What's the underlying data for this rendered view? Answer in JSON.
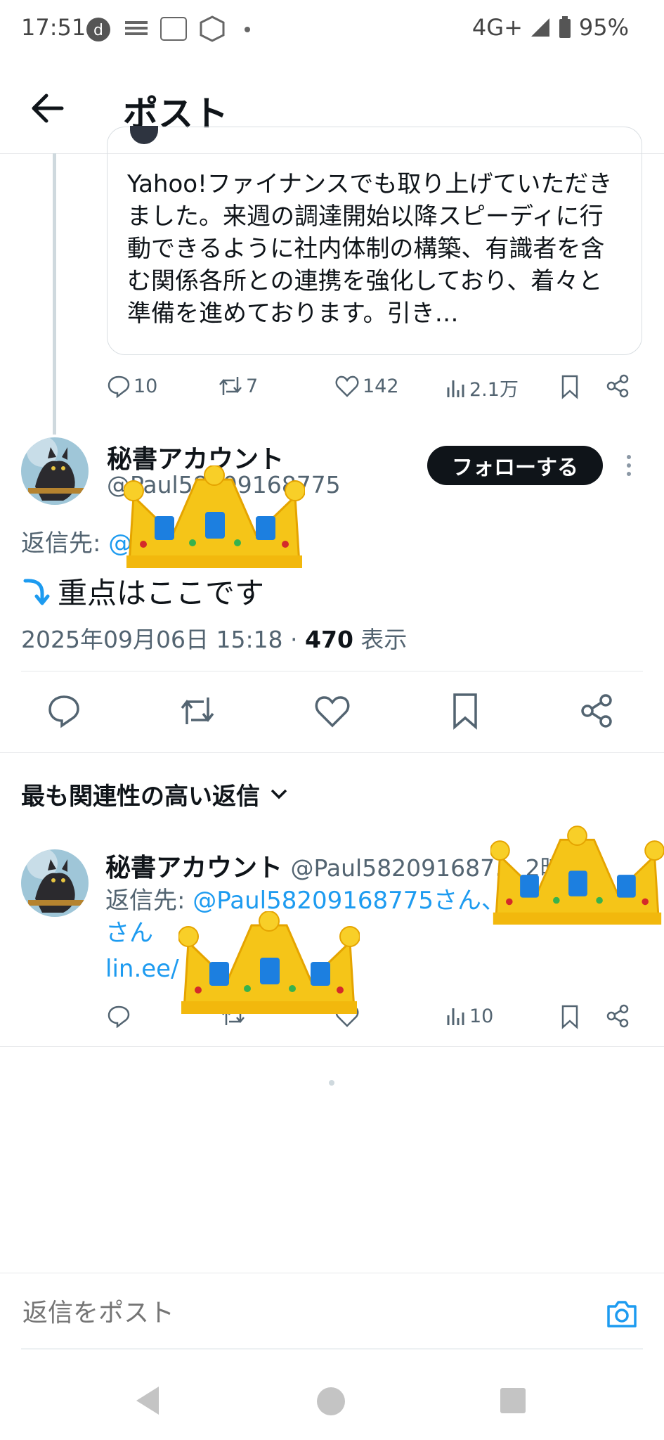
{
  "status_bar": {
    "time": "17:51",
    "network": "4G+",
    "battery": "95%"
  },
  "header": {
    "title": "ポスト"
  },
  "quoted_post": {
    "text": "Yahoo!ファイナンスでも取り上げていただきました。来週の調達開始以降スピーディに行動できるように社内体制の構築、有識者を含む関係各所との連携を強化しており、着々と準備を進めております。引き…",
    "replies": "10",
    "reposts": "7",
    "likes": "142",
    "views": "2.1万"
  },
  "main_post": {
    "name": "秘書アカウント",
    "handle": "@Paul58209168775",
    "follow_label": "フォローする",
    "reply_to_label": "返信先:",
    "reply_to_handle": "@",
    "text": "重点はここです",
    "timestamp": "2025年09月06日 15:18 · ",
    "views": "470",
    "views_label": " 表示"
  },
  "replies_section": {
    "title": "最も関連性の高い返信"
  },
  "reply_post": {
    "name": "秘書アカウント",
    "handle_time": "@Paul582091687… 2時間",
    "reply_to_label": "返信先: ",
    "reply_to_handles": "@Paul58209168775さん、",
    "reply_to_suffix": "さん",
    "link": "lin.ee/",
    "views": "10"
  },
  "compose": {
    "placeholder": "返信をポスト"
  },
  "colors": {
    "accent": "#1d9bf0",
    "text": "#0f1419",
    "secondary": "#536471"
  }
}
